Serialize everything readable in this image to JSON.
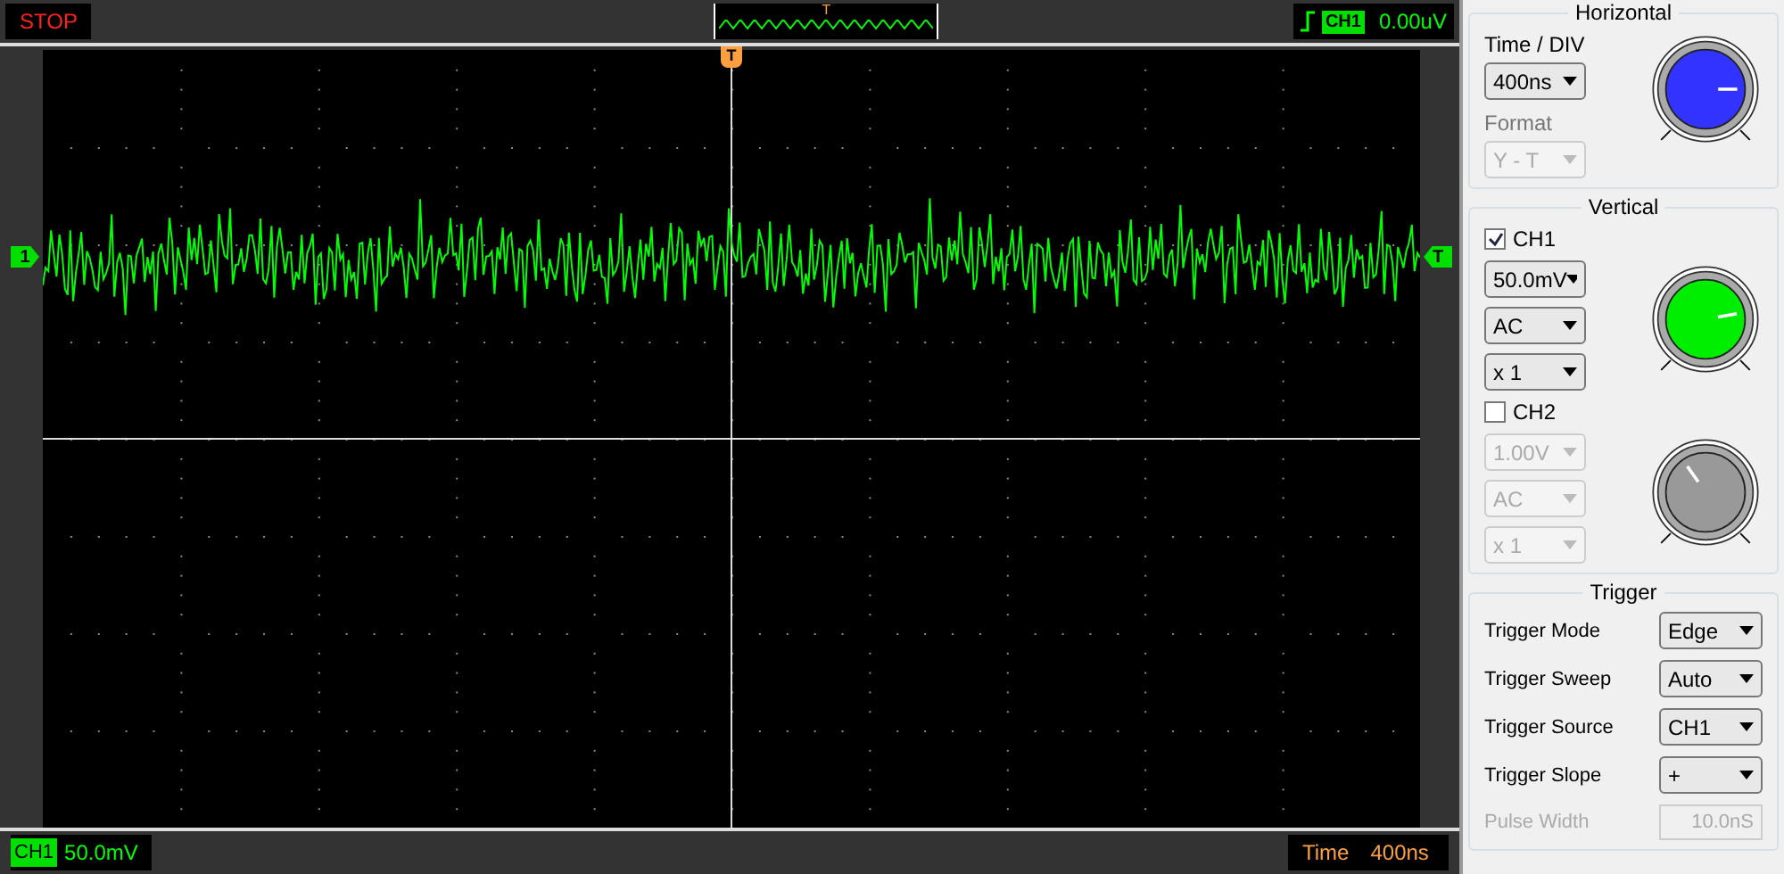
{
  "top_bar": {
    "run_state": "STOP",
    "trigger_preview": {
      "marker": "T"
    },
    "trigger_readout": {
      "channel": "CH1",
      "value": "0.00uV"
    }
  },
  "scope": {
    "top_marker": "T",
    "left_marker": "1",
    "right_marker": "T"
  },
  "status_bar": {
    "channel": "CH1",
    "volts": "50.0mV",
    "time_label": "Time",
    "time_value": "400ns"
  },
  "horizontal": {
    "title": "Horizontal",
    "time_div_label": "Time / DIV",
    "time_div": "400ns",
    "format_label": "Format",
    "format": "Y - T",
    "format_disabled": true
  },
  "vertical": {
    "title": "Vertical",
    "channels": [
      {
        "label": "CH1",
        "checked": true,
        "volts": "50.0mV",
        "coupling": "AC",
        "probe": "x 1"
      },
      {
        "label": "CH2",
        "checked": false,
        "volts": "1.00V",
        "coupling": "AC",
        "probe": "x 1"
      }
    ]
  },
  "trigger": {
    "title": "Trigger",
    "rows": [
      {
        "label": "Trigger Mode",
        "value": "Edge",
        "disabled": false,
        "kind": "dropdown"
      },
      {
        "label": "Trigger Sweep",
        "value": "Auto",
        "disabled": false,
        "kind": "dropdown"
      },
      {
        "label": "Trigger Source",
        "value": "CH1",
        "disabled": false,
        "kind": "dropdown"
      },
      {
        "label": "Trigger Slope",
        "value": "+",
        "disabled": false,
        "kind": "dropdown"
      },
      {
        "label": "Pulse Width",
        "value": "10.0nS",
        "disabled": true,
        "kind": "field"
      }
    ]
  }
}
